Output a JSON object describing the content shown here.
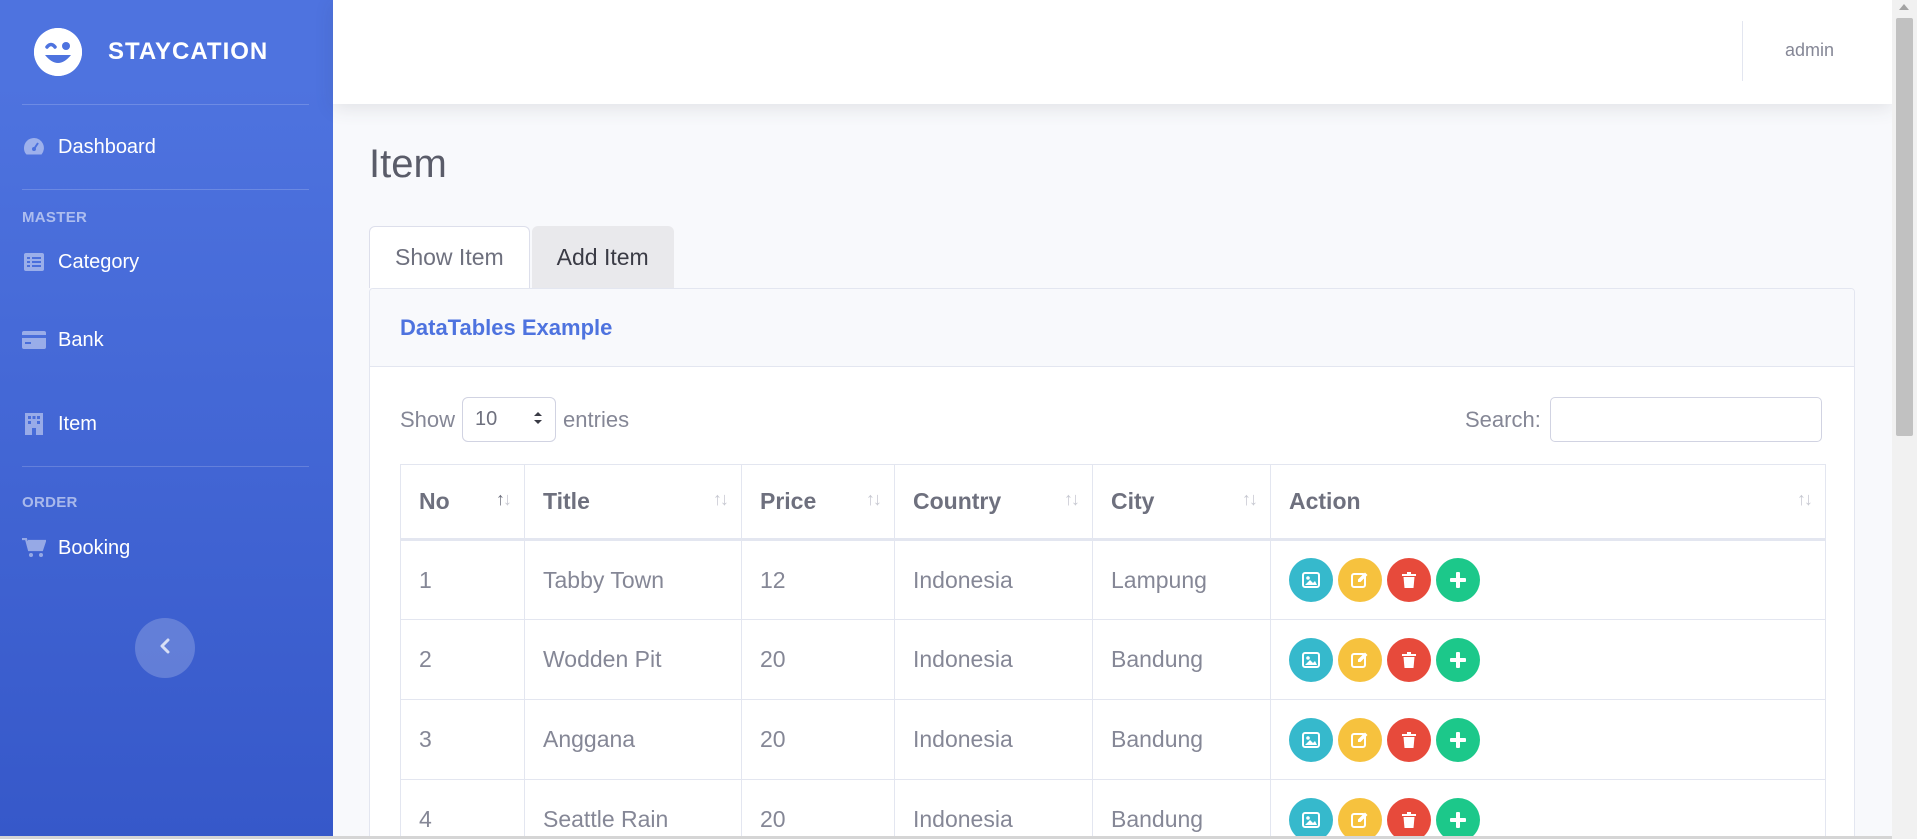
{
  "brand": {
    "name": "STAYCATION",
    "logo_icon": "laugh-wink-icon"
  },
  "sidebar": {
    "dashboard": {
      "label": "Dashboard",
      "icon": "tachometer-icon"
    },
    "heading_master": "MASTER",
    "items": [
      {
        "label": "Category",
        "icon": "list-icon"
      },
      {
        "label": "Bank",
        "icon": "credit-card-icon"
      },
      {
        "label": "Item",
        "icon": "building-icon"
      }
    ],
    "heading_order": "ORDER",
    "booking": {
      "label": "Booking",
      "icon": "shopping-cart-icon"
    }
  },
  "topbar": {
    "user": "admin"
  },
  "page": {
    "title": "Item"
  },
  "tabs": [
    {
      "label": "Show Item",
      "active": true
    },
    {
      "label": "Add Item",
      "active": false
    }
  ],
  "card": {
    "title": "DataTables Example"
  },
  "datatable": {
    "show_label": "Show",
    "entries_value": "10",
    "entries_label": "entries",
    "search_label": "Search:",
    "search_value": "",
    "columns": [
      "No",
      "Title",
      "Price",
      "Country",
      "City",
      "Action"
    ],
    "rows": [
      {
        "no": "1",
        "title": "Tabby Town",
        "price": "12",
        "country": "Indonesia",
        "city": "Lampung"
      },
      {
        "no": "2",
        "title": "Wodden Pit",
        "price": "20",
        "country": "Indonesia",
        "city": "Bandung"
      },
      {
        "no": "3",
        "title": "Anggana",
        "price": "20",
        "country": "Indonesia",
        "city": "Bandung"
      },
      {
        "no": "4",
        "title": "Seattle Rain",
        "price": "20",
        "country": "Indonesia",
        "city": "Bandung"
      }
    ],
    "action_icons": [
      "image-icon",
      "edit-icon",
      "trash-icon",
      "plus-icon"
    ]
  },
  "colors": {
    "primary": "#4e73df",
    "info": "#36b9cc",
    "warning": "#f6c23e",
    "danger": "#e74a3b",
    "success": "#1cc88a"
  }
}
